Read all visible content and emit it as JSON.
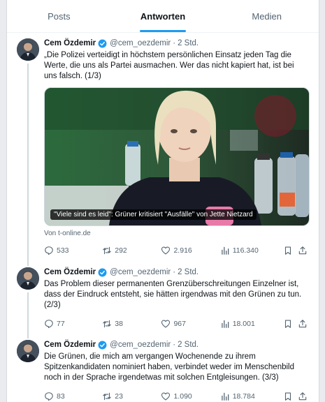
{
  "tabs": [
    {
      "label": "Posts",
      "active": false
    },
    {
      "label": "Antworten",
      "active": true
    },
    {
      "label": "Medien",
      "active": false
    }
  ],
  "colors": {
    "accent": "#1d9bf0",
    "verified": "#1d9bf0",
    "muted": "#536471",
    "text": "#0f1419"
  },
  "posts": [
    {
      "author": "Cem Özdemir",
      "handle": "@cem_oezdemir",
      "separator": "·",
      "time": "2 Std.",
      "text": "„Die Polizei verteidigt in höchstem persönlichen Einsatz jeden Tag die Werte, die uns als Partei ausmachen. Wer das nicht kapiert hat, ist bei uns falsch. (1/3)",
      "card_caption": "\"Viele sind es leid\": Grüner kritisiert \"Ausfälle\" von Jette Nietzard",
      "card_source": "Von t-online.de",
      "replies": "533",
      "reposts": "292",
      "likes": "2.916",
      "views": "116.340"
    },
    {
      "author": "Cem Özdemir",
      "handle": "@cem_oezdemir",
      "separator": "·",
      "time": "2 Std.",
      "text": "Das Problem dieser permanenten Grenzüberschreitungen Einzelner ist, dass der Eindruck entsteht, sie hätten irgendwas mit den Grünen zu tun. (2/3)",
      "replies": "77",
      "reposts": "38",
      "likes": "967",
      "views": "18.001"
    },
    {
      "author": "Cem Özdemir",
      "handle": "@cem_oezdemir",
      "separator": "·",
      "time": "2 Std.",
      "text": "Die Grünen, die mich am vergangen Wochenende zu ihrem Spitzenkandidaten nominiert haben, verbindet weder im Menschenbild noch in der Sprache irgendetwas mit solchen Entgleisungen. (3/3)",
      "replies": "83",
      "reposts": "23",
      "likes": "1.090",
      "views": "18.784"
    }
  ],
  "icons": [
    "reply-icon",
    "repost-icon",
    "like-icon",
    "views-icon",
    "bookmark-icon",
    "share-icon",
    "verified-badge-icon"
  ]
}
